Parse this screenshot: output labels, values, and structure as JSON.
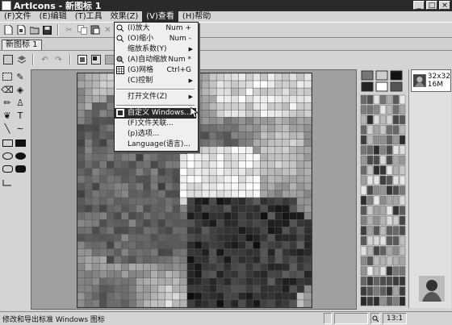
{
  "window": {
    "title": "ArtIcons - 新图标 1"
  },
  "title_controls": [
    "_",
    "□",
    "×"
  ],
  "menubar": [
    {
      "label": "(F)文件"
    },
    {
      "label": "(E)编辑"
    },
    {
      "label": "(T)工具"
    },
    {
      "label": "效果(Z)"
    },
    {
      "label": "(V)查看"
    },
    {
      "label": "(H)帮助"
    }
  ],
  "active_menu_index": 4,
  "doc_tab": {
    "label": "新图标 1"
  },
  "dropdown": [
    {
      "label": "(I)放大",
      "shortcut": "Num +",
      "icon": "zoom-in-icon",
      "submenu": false
    },
    {
      "label": "(O)缩小",
      "shortcut": "Num -",
      "icon": "zoom-out-icon",
      "submenu": false
    },
    {
      "label": "缩放系数(Y)",
      "shortcut": "",
      "icon": "",
      "submenu": true
    },
    {
      "label": "(A)自动缩放",
      "shortcut": "Num *",
      "icon": "auto-zoom-icon",
      "submenu": false
    },
    {
      "label": "(G)网格",
      "shortcut": "Ctrl+G",
      "icon": "grid-icon",
      "submenu": false
    },
    {
      "label": "(C)控制",
      "shortcut": "",
      "icon": "",
      "submenu": true
    },
    {
      "label": "打开文件(Z)",
      "shortcut": "",
      "icon": "",
      "submenu": true
    },
    {
      "label": "自定义 Windows...",
      "shortcut": "",
      "icon": "windows-icon",
      "submenu": false,
      "highlighted": true
    },
    {
      "label": "(F)文件关联...",
      "shortcut": "",
      "icon": "",
      "submenu": false
    },
    {
      "label": "(p)选项...",
      "shortcut": "",
      "icon": "",
      "submenu": false
    },
    {
      "label": "Language(语言)...",
      "shortcut": "",
      "icon": "",
      "submenu": false
    }
  ],
  "preview": {
    "size": "32x32",
    "colors": "16M"
  },
  "statusbar": {
    "message": "修改和导出标准 Windows 图标",
    "zoom": "13:1"
  },
  "colors": {
    "titlebar": "#2a2a2a",
    "highlight": "#2a2a2a",
    "window_bg": "#d4d4d4"
  }
}
